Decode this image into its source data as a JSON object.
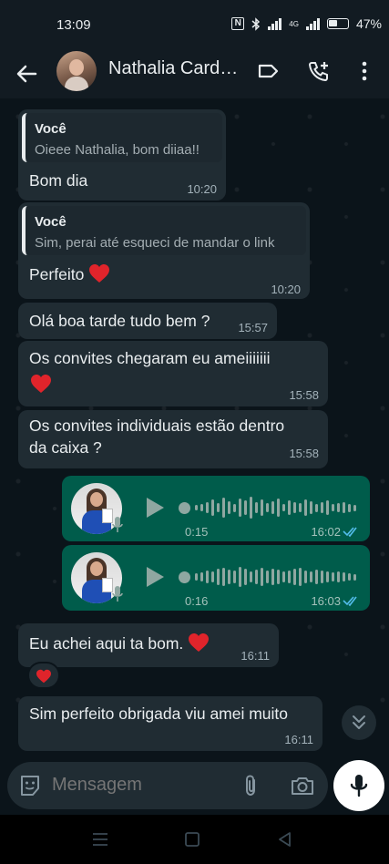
{
  "status": {
    "time": "13:09",
    "nfc": "N",
    "network": "4G",
    "battery": "47%"
  },
  "header": {
    "title": "Nathalia Cardo..."
  },
  "messages": [
    {
      "quote_name": "Você",
      "quote_text": "Oieee Nathalia, bom diiaa!!",
      "text": "Bom dia",
      "time": "10:20"
    },
    {
      "quote_name": "Você",
      "quote_text": "Sim, perai até esqueci de mandar o link",
      "text": "Perfeito",
      "time": "10:20"
    },
    {
      "text": "Olá boa tarde tudo bem ?",
      "time": "15:57"
    },
    {
      "text": "Os convites chegaram eu ameiiiiiii",
      "time": "15:58"
    },
    {
      "line1": "Os convites individuais estão dentro",
      "line2": "da caixa ?",
      "time": "15:58"
    },
    {
      "type": "voice",
      "duration": "0:15",
      "time": "16:02",
      "progress": 0
    },
    {
      "type": "voice",
      "duration": "0:16",
      "time": "16:03",
      "progress": 0
    },
    {
      "text": "Eu achei aqui ta bom.",
      "time": "16:11",
      "reaction": "heart"
    },
    {
      "text": "Sim perfeito obrigada viu amei muito",
      "time": "16:11"
    }
  ],
  "input": {
    "placeholder": "Mensagem"
  },
  "colors": {
    "accent": "#00a884",
    "outgoing": "#005c4b",
    "incoming": "#202c33",
    "read_ticks": "#53bdeb",
    "heart": "#e0242b"
  },
  "icons": [
    "back-arrow-icon",
    "label-icon",
    "add-call-icon",
    "more-vert-icon",
    "play-icon",
    "mic-icon",
    "double-check-icon",
    "heart-icon",
    "chevron-double-down-icon",
    "emoji-icon",
    "attach-icon",
    "camera-icon",
    "nav-menu-icon",
    "nav-home-icon",
    "nav-back-icon"
  ]
}
